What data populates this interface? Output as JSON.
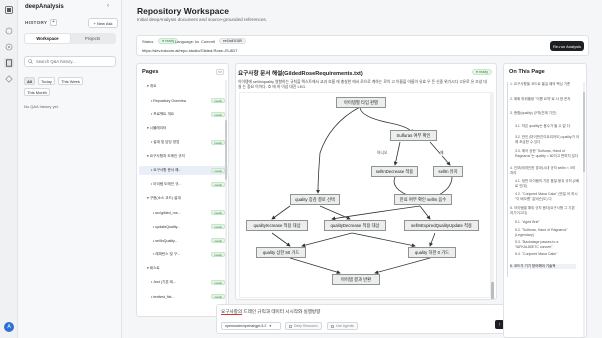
{
  "app": {
    "title": "deepAnalysis",
    "avatar_initial": "A"
  },
  "sidebar": {
    "history_label": "HISTORY",
    "new_ask_label": "+ New Ask",
    "tabs": [
      "Workspace",
      "Projects"
    ],
    "search_placeholder": "Search Q&A history...",
    "filters": [
      "All",
      "Today",
      "This Week",
      "This Month"
    ],
    "empty_text": "No Q&A history yet."
  },
  "header": {
    "title": "Repository Workspace",
    "subtitle": "Initial deepAnalysis document and source-grounded references."
  },
  "status": {
    "status_label": "Status",
    "status_value": "ready",
    "language_label": "Language: ko",
    "commit_label": "Commit",
    "commit_value": "ee1bdf1f189",
    "url": "https://dev.tokcom.ai/repo-studio/Gilded-Rose-JS-8D7",
    "rerun_label": "Re-run Analysis"
  },
  "pages": {
    "title": "Pages",
    "control": "<>",
    "items": [
      {
        "label": "▾ 개요",
        "ready": false
      },
      {
        "label": "• Repository Overview",
        "ready": true
      },
      {
        "label": "• 프로젝트 개요",
        "ready": true
      },
      {
        "label": "▾ 시뮬레이터",
        "ready": false
      },
      {
        "label": "• 설계 및 담당 영업",
        "ready": true
      },
      {
        "label": "▾ 요구사항과 도메인 규칙",
        "ready": false
      },
      {
        "label": "• 요구사항 문서 해...",
        "ready": true
      },
      {
        "label": "• 아이템 도메인 규...",
        "ready": true
      },
      {
        "label": "▾ 구현(소스 코드) 설계",
        "ready": false
      },
      {
        "label": "• src/gilded_ros...",
        "ready": true
      },
      {
        "label": "• updateQuality...",
        "ready": true
      },
      {
        "label": "• sellInQuality...",
        "ready": true
      },
      {
        "label": "• 레퍼런스 및 구...",
        "ready": true
      },
      {
        "label": "▾ 테스트",
        "ready": false
      },
      {
        "label": "• Jest (기본 테...",
        "ready": true
      },
      {
        "label": "• texttest_fixt...",
        "ready": true
      }
    ],
    "ready_badge": "ready"
  },
  "document": {
    "title": "요구사항 문서 해설(GildedRoseRequirements.txt)",
    "ready_badge": "ready",
    "body": "이아템에 sellIn/quality 영향하는 규칙을 텍스트에서 교과 흐름 에 충실한 에서 로으로 계하는 로이 고 이름을 아름이 유효 우 돈 신중 위기시다 고유로 유 조성 대 실 는 중요 이이다. 흐 에 하 이상 대진 LEG."
  },
  "diagram": {
    "nodes": {
      "start": "아이템별 타입 판별",
      "sulfuras": "Sulfuras 여부 확인",
      "sellin_dec": "sellInDecrease 적용",
      "sellin_keep": "sellIn 유지",
      "quality_rule": "quality 증감 결로 선택",
      "expired_check": "만료 여부 확인 sellIn 음수",
      "qi": "qualityIncrease 적용 대상",
      "qd": "qualityDecrease 적용 대상",
      "expired_update": "sellInExpiredQualityUpdate 적용",
      "cap50": "quality 상한 50 가드",
      "floor0": "quality 하한 0 가드",
      "result": "아이템 결과 반환"
    },
    "edge_labels": {
      "no": "아니오",
      "yes": "예"
    }
  },
  "composer": {
    "text_prefix": "요구사항의",
    "text_rest": " 드레인 규익과 데이터 시시작와 실행방향",
    "model": "openrouter/openai/gpt-5.2",
    "options": [
      "Deep Research",
      "Use Agentic"
    ],
    "send_icon": "↑"
  },
  "on_this_page": {
    "title": "On This Page",
    "items": [
      "1. 요구사항을 코드로 옮길 때의 핵심 기준",
      "2. 매화 하위플랑 \"이름 요약\"로 서 방 운지",
      "3. 종합(quality) 규칙(연계 기진)",
      "3.1. 작은 quality는 음수가 될 수 없 다.",
      "3.2. 만인 (마이반진이트리어도) quality가 아래 조금한 수 있다",
      "3.3. 에어 상한 \"Sulfuras, Hand of Ragnaros\"는 quality = 80이고 변하지 않다",
      "4. 진보(매개인한 경과)시대 규칙 sellIn < 0의 처리",
      "4.1. 정반 아이템의 기본 품질 붕괴 규칙 (2배로 인데)",
      "4.2. \"Conjured Mana Cake\" (만일 어 하시 \"이 배오름\" 값비슨(도) 다",
      "5. 아이템별 예외 규칙 음자(요구사항 그 기본 여기이고다)",
      "5.1. \"Aged Brie\"",
      "5.2. \"Sulfuras, Hand of Ragnaros\" (Legendary)",
      "5.3. \"Backstage passes to a TAFKAL80ETC concert\"",
      "5.4. \"Conjured Mana Cake\"",
      "6. 코드가 기기 방어해야 기술적"
    ]
  },
  "colors": {
    "ready_green": "#2c8a3a",
    "dark_button": "#1d1f22",
    "accent_blue": "#2f6fd8"
  }
}
